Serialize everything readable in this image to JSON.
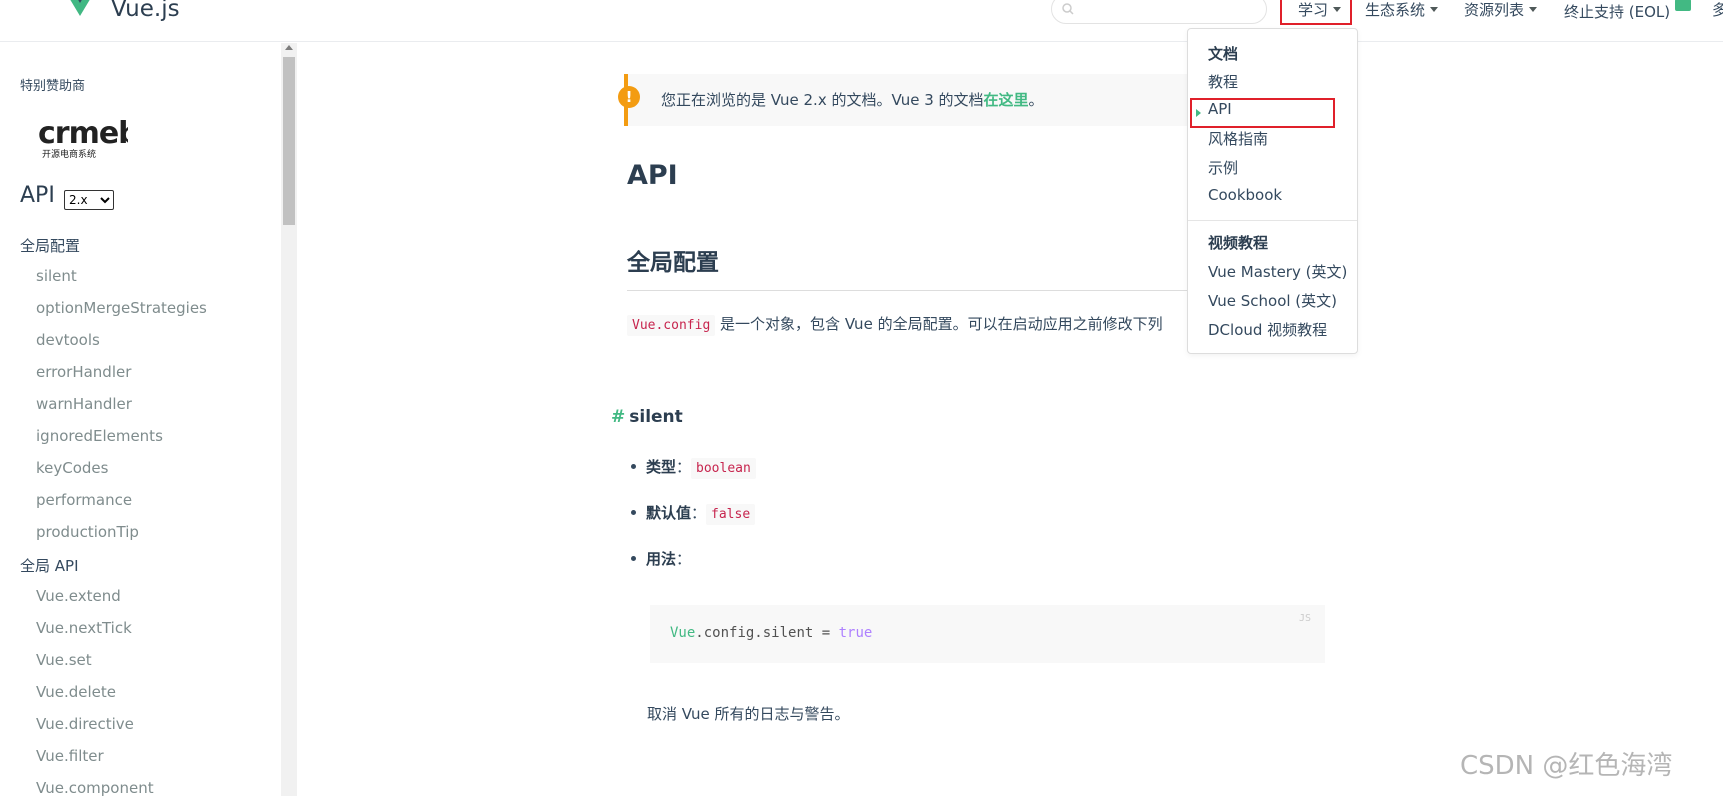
{
  "header": {
    "brand": "Vue.js",
    "search_placeholder": "",
    "nav": [
      {
        "label": "学习",
        "has_caret": true
      },
      {
        "label": "生态系统",
        "has_caret": true
      },
      {
        "label": "资源列表",
        "has_caret": true
      },
      {
        "label": "终止支持 (EOL)",
        "has_caret": false
      }
    ],
    "more_label": "多"
  },
  "dropdown": {
    "section1_title": "文档",
    "section1_items": [
      "教程",
      "API",
      "风格指南",
      "示例",
      "Cookbook"
    ],
    "section2_title": "视频教程",
    "section2_items": [
      "Vue Mastery (英文)",
      "Vue School (英文)",
      "DCloud 视频教程"
    ],
    "active_item": "API"
  },
  "sidebar": {
    "sponsor_label": "特别赞助商",
    "sponsor_logo_text": "crmeb",
    "sponsor_logo_sub": "开源电商系统",
    "title": "API",
    "version": "2.x",
    "section_global_config": "全局配置",
    "global_config_items": [
      "silent",
      "optionMergeStrategies",
      "devtools",
      "errorHandler",
      "warnHandler",
      "ignoredElements",
      "keyCodes",
      "performance",
      "productionTip"
    ],
    "section_global_api": "全局 API",
    "global_api_items": [
      "Vue.extend",
      "Vue.nextTick",
      "Vue.set",
      "Vue.delete",
      "Vue.directive",
      "Vue.filter",
      "Vue.component"
    ]
  },
  "main": {
    "notice_prefix": "您正在浏览的是 Vue 2.x 的文档。Vue 3 的文档",
    "notice_link": "在这里",
    "notice_suffix": "。",
    "title": "API",
    "section_title": "全局配置",
    "config_code": "Vue.config",
    "config_desc": " 是一个对象，包含 Vue 的全局配置。可以在启动应用之前修改下列",
    "silent_heading": "silent",
    "type_label": "类型",
    "type_value": "boolean",
    "default_label": "默认值",
    "default_value": "false",
    "usage_label": "用法",
    "colon": "：",
    "code_lang": "JS",
    "code_obj": "Vue",
    "code_mid": ".config.silent = ",
    "code_val": "true",
    "usage_desc": "取消 Vue 所有的日志与警告。"
  },
  "watermark": "CSDN @红色海湾",
  "colors": {
    "accent": "#42b983",
    "warning": "#f39c12",
    "highlight": "#e0202a"
  }
}
